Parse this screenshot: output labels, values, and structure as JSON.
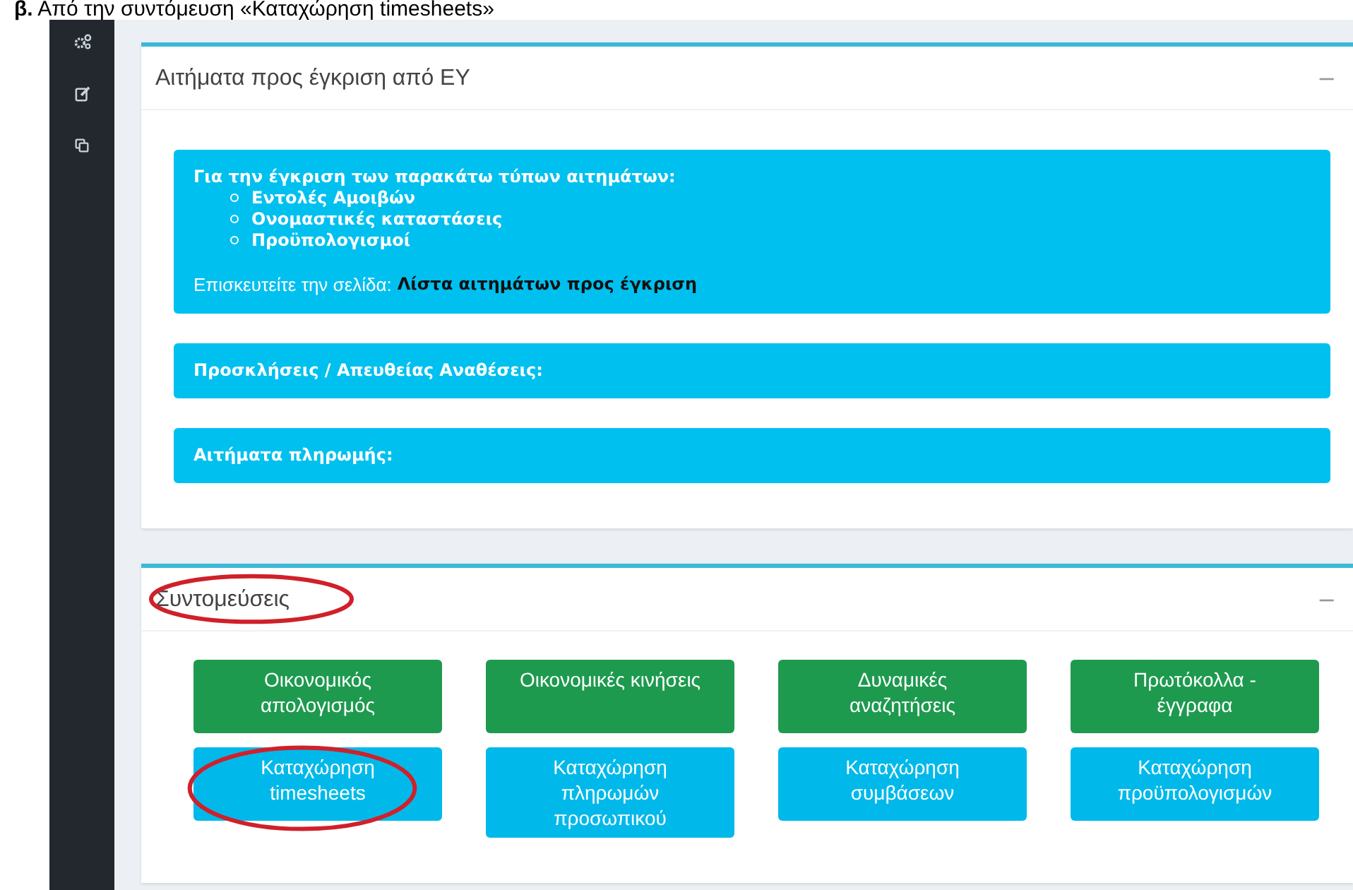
{
  "caption": {
    "text": "**β.** Από την συντόμευση «Καταχώρηση timesheets»"
  },
  "panels": [
    {
      "title": "Αιτήματα προς έγκριση από ΕΥ",
      "highlighted": false,
      "collapse": "−",
      "callouts": [
        {
          "heading": "Για την έγκριση των παρακάτω τύπων αιτημάτων:",
          "items": [
            "Εντολές Αμοιβών",
            "Ονομαστικές καταστάσεις",
            "Προϋπολογισμοί"
          ],
          "note": "Επισκευτείτε την σελίδα:",
          "link": "Λίστα αιτημάτων προς έγκριση"
        },
        {
          "heading": "Προσκλήσεις / Απευθείας Αναθέσεις:"
        },
        {
          "heading": "Αιτήματα πληρωμής:"
        }
      ]
    },
    {
      "title": "Συντομεύσεις",
      "highlighted": true,
      "collapse": "−",
      "shortcuts": [
        {
          "label": "Οικονομικός απολογισμός",
          "color": "#1e9a4f",
          "highlighted": false
        },
        {
          "label": "Οικονομικές κινήσεις",
          "color": "#1e9a4f",
          "highlighted": false
        },
        {
          "label": "Δυναμικές αναζητήσεις",
          "color": "#1e9a4f",
          "highlighted": false
        },
        {
          "label": "Πρωτόκολλα - έγγραφα",
          "color": "#1e9a4f",
          "highlighted": false
        },
        {
          "label": "Καταχώρηση timesheets",
          "color": "#00b9ea",
          "highlighted": true
        },
        {
          "label": "Καταχώρηση πληρωμών προσωπικού",
          "color": "#00b9ea",
          "highlighted": false
        },
        {
          "label": "Καταχώρηση συμβάσεων",
          "color": "#00b9ea",
          "highlighted": false
        },
        {
          "label": "Καταχώρηση προϋπολογισμών",
          "color": "#00b9ea",
          "highlighted": false
        }
      ]
    }
  ]
}
